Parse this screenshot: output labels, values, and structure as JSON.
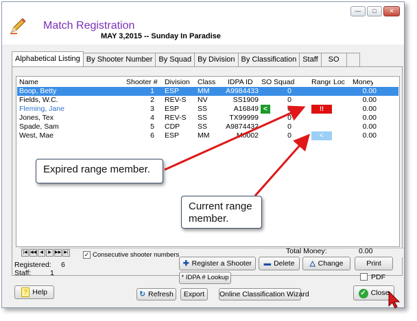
{
  "window": {
    "title": "Match Registration",
    "subtitle": "MAY  3,2015 -- Sunday In Paradise",
    "buttons": [
      "minimize",
      "maximize",
      "close"
    ]
  },
  "tabs": [
    {
      "label": "Alphabetical Listing",
      "active": true
    },
    {
      "label": "By Shooter Number"
    },
    {
      "label": "By Squad"
    },
    {
      "label": "By Division"
    },
    {
      "label": "By Classification"
    },
    {
      "label": "Staff"
    },
    {
      "label": "SO"
    },
    {
      "label": ""
    }
  ],
  "grid": {
    "columns": [
      "Name",
      "Shooter #",
      "Division",
      "Class",
      "IDPA ID",
      "SO",
      "Squad",
      "Range",
      "Loc",
      "Money"
    ],
    "rows": [
      {
        "name": "Boop, Betty",
        "shooter": "1",
        "division": "ESP",
        "class": "MM",
        "idpa": "A9984433",
        "so": "",
        "squad": "0",
        "range": "",
        "loc": "",
        "money": "0.00",
        "selected": true
      },
      {
        "name": "Fields, W.C.",
        "shooter": "2",
        "division": "REV-S",
        "class": "NV",
        "idpa": "SS1909",
        "so": "",
        "squad": "0",
        "range": "",
        "loc": "",
        "money": "0.00"
      },
      {
        "name": "Fleming, Jane",
        "shooter": "3",
        "division": "ESP",
        "class": "SS",
        "idpa": "A16849",
        "so": "<",
        "squad": "0",
        "range": "!!",
        "loc": "",
        "money": "0.00",
        "highlight": true
      },
      {
        "name": "Jones, Tex",
        "shooter": "4",
        "division": "REV-S",
        "class": "SS",
        "idpa": "TX99999",
        "so": "",
        "squad": "0",
        "range": "",
        "loc": "",
        "money": "0.00"
      },
      {
        "name": "Spade, Sam",
        "shooter": "5",
        "division": "CDP",
        "class": "SS",
        "idpa": "A9874432",
        "so": "",
        "squad": "0",
        "range": "",
        "loc": "",
        "money": "0.00"
      },
      {
        "name": "West, Mae",
        "shooter": "6",
        "division": "ESP",
        "class": "MM",
        "idpa": "M0002",
        "so": "",
        "squad": "0",
        "range": "<",
        "loc": "",
        "money": "0.00"
      }
    ],
    "nav_buttons": [
      "|◀",
      "◀◀",
      "◀",
      "▶",
      "▶▶",
      "▶|"
    ]
  },
  "colors": {
    "so_current": "#1c9b2c",
    "range_expired": "#e01010",
    "range_current": "#9ccff5",
    "selected_row": "#3a8ee6",
    "title": "#7b2fb5"
  },
  "options": {
    "consecutive_label": "Consecutive shooter numbers",
    "consecutive_checked": true,
    "pdf_label": "PDF",
    "pdf_checked": false
  },
  "totals": {
    "money_label": "Total Money:",
    "money_value": "0.00",
    "registered_label": "Registered:",
    "registered_value": "6",
    "staff_label": "Staff:",
    "staff_value": "1"
  },
  "buttons": {
    "register": "Register a Shooter",
    "delete": "Delete",
    "change": "Change",
    "print": "Print",
    "idpa_lookup": "* IDPA # Lookup",
    "help": "Help",
    "refresh": "Refresh",
    "export": "Export",
    "wizard": "Online Classification Wizard",
    "close": "Close"
  },
  "callouts": {
    "expired": "Expired range member.",
    "current": "Current range member."
  }
}
